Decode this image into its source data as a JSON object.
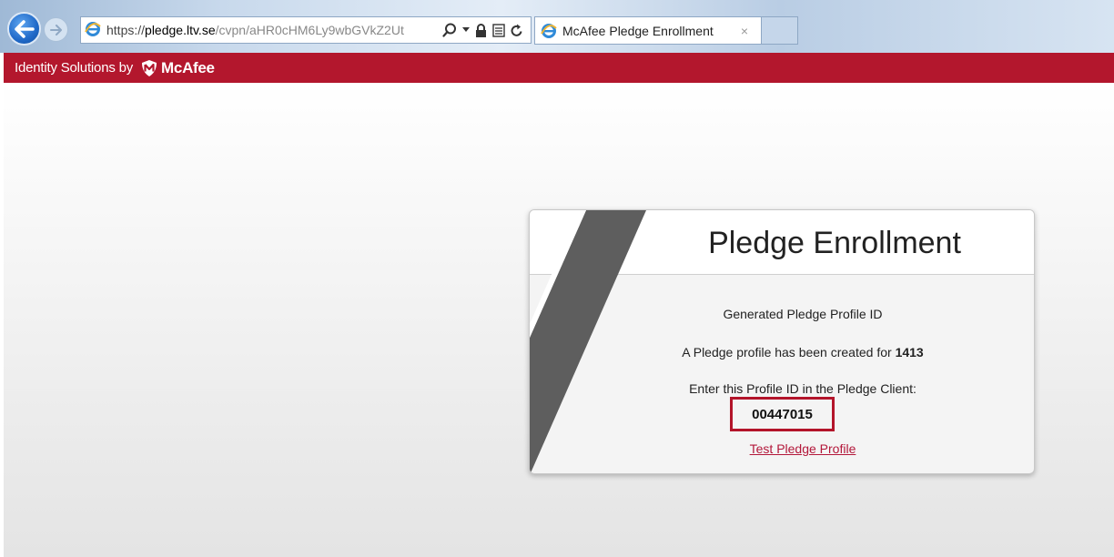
{
  "browser": {
    "url_protocol": "https://",
    "url_host": "pledge.ltv.se",
    "url_rest": "/cvpn/aHR0cHM6Ly9wbGVkZ2Ut",
    "tab_title": "McAfee Pledge Enrollment",
    "tab_close": "×"
  },
  "header": {
    "brand_text": "Identity Solutions by",
    "brand_name": "McAfee",
    "color": "#b3172d"
  },
  "card": {
    "title": "Pledge Enrollment",
    "generated_label": "Generated Pledge Profile ID",
    "created_prefix": "A Pledge profile has been created for",
    "created_user": "1413",
    "enter_instruction": "Enter this Profile ID in the Pledge Client:",
    "profile_id": "00447015",
    "test_link": "Test Pledge Profile"
  },
  "icons": [
    "back-arrow-icon",
    "forward-arrow-icon",
    "ie-icon",
    "search-icon",
    "dropdown-icon",
    "lock-icon",
    "compat-view-icon",
    "refresh-icon",
    "mcafee-shield-icon"
  ]
}
